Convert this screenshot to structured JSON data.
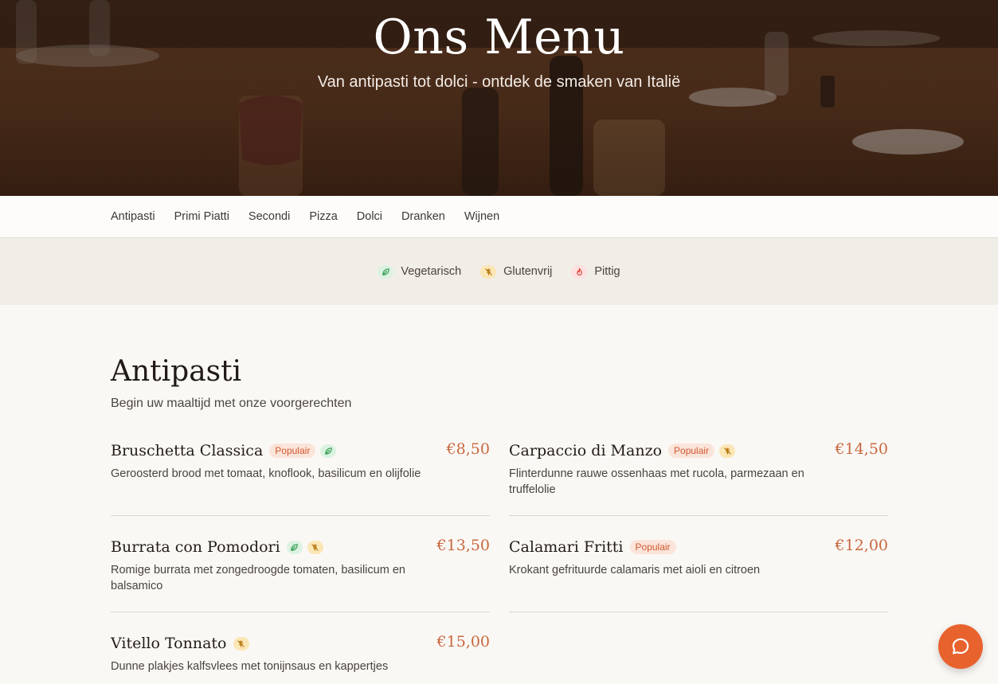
{
  "hero": {
    "title": "Ons Menu",
    "subtitle": "Van antipasti tot dolci - ontdek de smaken van Italië"
  },
  "nav": {
    "categories": [
      "Antipasti",
      "Primi Piatti",
      "Secondi",
      "Pizza",
      "Dolci",
      "Dranken",
      "Wijnen"
    ]
  },
  "legend": {
    "vegetarian": "Vegetarisch",
    "gluten_free": "Glutenvrij",
    "spicy": "Pittig"
  },
  "section": {
    "title": "Antipasti",
    "description": "Begin uw maaltijd met onze voorgerechten"
  },
  "items": [
    {
      "name": "Bruschetta Classica",
      "price": "€8,50",
      "popular_label": "Populair",
      "tags": [
        "vegetarian"
      ],
      "description": "Geroosterd brood met tomaat, knoflook, basilicum en olijfolie"
    },
    {
      "name": "Carpaccio di Manzo",
      "price": "€14,50",
      "popular_label": "Populair",
      "tags": [
        "gluten-free"
      ],
      "description": "Flinterdunne rauwe ossenhaas met rucola, parmezaan en truffelolie"
    },
    {
      "name": "Burrata con Pomodori",
      "price": "€13,50",
      "tags": [
        "vegetarian",
        "gluten-free"
      ],
      "description": "Romige burrata met zongedroogde tomaten, basilicum en balsamico"
    },
    {
      "name": "Calamari Fritti",
      "price": "€12,00",
      "popular_label": "Populair",
      "tags": [],
      "description": "Krokant gefrituurde calamaris met aioli en citroen"
    },
    {
      "name": "Vitello Tonnato",
      "price": "€15,00",
      "tags": [
        "gluten-free"
      ],
      "description": "Dunne plakjes kalfsvlees met tonijnsaus en kappertjes"
    }
  ],
  "colors": {
    "accent": "#c8673e",
    "fab": "#e8622e",
    "vegetarian": "#2e9a4f",
    "gluten_free": "#b77712",
    "spicy": "#d83c35"
  },
  "icons": {
    "vegetarian": "leaf-icon",
    "gluten_free": "wheat-off-icon",
    "spicy": "flame-icon",
    "chat": "chat-bubble-icon"
  }
}
